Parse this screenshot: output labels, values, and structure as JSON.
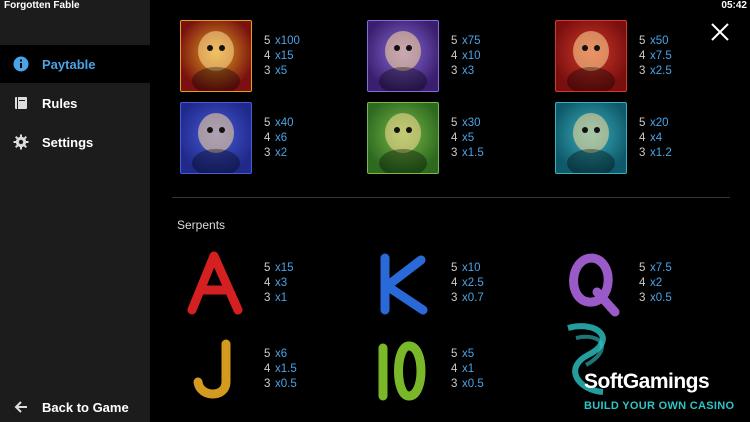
{
  "app": {
    "title": "Forgotten Fable",
    "clock": "05:42"
  },
  "sidebar": {
    "items": [
      {
        "label": "Paytable",
        "icon": "info-icon"
      },
      {
        "label": "Rules",
        "icon": "book-icon"
      },
      {
        "label": "Settings",
        "icon": "gear-icon"
      }
    ],
    "back_label": "Back to Game"
  },
  "paytable": {
    "symbols": [
      {
        "name": "egg",
        "pays": [
          [
            "5",
            "x100"
          ],
          [
            "4",
            "x15"
          ],
          [
            "3",
            "x5"
          ]
        ],
        "colors": [
          "#7a1010",
          "#e0a020"
        ]
      },
      {
        "name": "zombie-king",
        "pays": [
          [
            "5",
            "x75"
          ],
          [
            "4",
            "x10"
          ],
          [
            "3",
            "x3"
          ]
        ],
        "colors": [
          "#3a1f6e",
          "#8a6ad8"
        ]
      },
      {
        "name": "frog-hero",
        "pays": [
          [
            "5",
            "x50"
          ],
          [
            "4",
            "x7.5"
          ],
          [
            "3",
            "x2.5"
          ]
        ],
        "colors": [
          "#7a0f0f",
          "#d23a2a"
        ]
      },
      {
        "name": "pirate",
        "pays": [
          [
            "5",
            "x40"
          ],
          [
            "4",
            "x6"
          ],
          [
            "3",
            "x2"
          ]
        ],
        "colors": [
          "#1f2a8a",
          "#4a5ad8"
        ]
      },
      {
        "name": "tree-man",
        "pays": [
          [
            "5",
            "x30"
          ],
          [
            "4",
            "x5"
          ],
          [
            "3",
            "x1.5"
          ]
        ],
        "colors": [
          "#2d6a1f",
          "#7ab84a"
        ]
      },
      {
        "name": "goblin",
        "pays": [
          [
            "5",
            "x20"
          ],
          [
            "4",
            "x4"
          ],
          [
            "3",
            "x1.2"
          ]
        ],
        "colors": [
          "#0f5a6a",
          "#3ab0c0"
        ]
      }
    ],
    "section_title": "Serpents",
    "serpents": [
      {
        "name": "serpent-a",
        "pays": [
          [
            "5",
            "x15"
          ],
          [
            "4",
            "x3"
          ],
          [
            "3",
            "x1"
          ]
        ],
        "color": "#d42020"
      },
      {
        "name": "serpent-k",
        "pays": [
          [
            "5",
            "x10"
          ],
          [
            "4",
            "x2.5"
          ],
          [
            "3",
            "x0.7"
          ]
        ],
        "color": "#2a6ad8"
      },
      {
        "name": "serpent-q",
        "pays": [
          [
            "5",
            "x7.5"
          ],
          [
            "4",
            "x2"
          ],
          [
            "3",
            "x0.5"
          ]
        ],
        "color": "#9a5ac8"
      },
      {
        "name": "serpent-j",
        "pays": [
          [
            "5",
            "x6"
          ],
          [
            "4",
            "x1.5"
          ],
          [
            "3",
            "x0.5"
          ]
        ],
        "color": "#d49a20"
      },
      {
        "name": "serpent-10",
        "pays": [
          [
            "5",
            "x5"
          ],
          [
            "4",
            "x1"
          ],
          [
            "3",
            "x0.5"
          ]
        ],
        "color": "#7ab82a"
      }
    ]
  },
  "watermark": {
    "name": "SoftGamings",
    "tagline": "BUILD YOUR OWN CASINO"
  },
  "colors": {
    "accent": "#4aa3e6",
    "sidebar": "#1c1c1c",
    "background": "#000000"
  }
}
